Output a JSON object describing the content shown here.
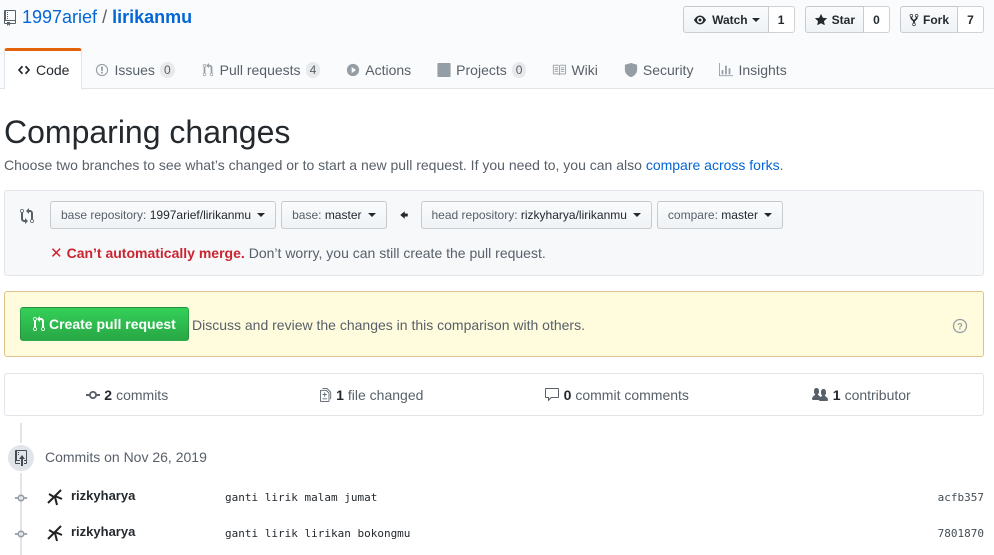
{
  "repo": {
    "owner": "1997arief",
    "separator": "/",
    "name": "lirikanmu"
  },
  "actions": {
    "watch_label": "Watch",
    "watch_count": "1",
    "star_label": "Star",
    "star_count": "0",
    "fork_label": "Fork",
    "fork_count": "7"
  },
  "nav": [
    {
      "label": "Code",
      "icon": "code-icon",
      "counter": null
    },
    {
      "label": "Issues",
      "icon": "issue-icon",
      "counter": "0"
    },
    {
      "label": "Pull requests",
      "icon": "pull-request-icon",
      "counter": "4"
    },
    {
      "label": "Actions",
      "icon": "play-icon",
      "counter": null
    },
    {
      "label": "Projects",
      "icon": "project-icon",
      "counter": "0"
    },
    {
      "label": "Wiki",
      "icon": "book-icon",
      "counter": null
    },
    {
      "label": "Security",
      "icon": "shield-icon",
      "counter": null
    },
    {
      "label": "Insights",
      "icon": "graph-icon",
      "counter": null
    }
  ],
  "compare": {
    "title": "Comparing changes",
    "description_prefix": "Choose two branches to see what’s changed or to start a new pull request. If you need to, you can also ",
    "description_link": "compare across forks",
    "description_suffix": ".",
    "base_repo_label": "base repository: ",
    "base_repo_value": "1997arief/lirikanmu",
    "base_label": "base: ",
    "base_value": "master",
    "head_repo_label": "head repository: ",
    "head_repo_value": "rizkyharya/lirikanmu",
    "compare_label": "compare: ",
    "compare_value": "master",
    "merge_error": "Can’t automatically merge.",
    "merge_note": "Don’t worry, you can still create the pull request.",
    "create_pr_label": "Create pull request",
    "create_pr_desc": "Discuss and review the changes in this comparison with others."
  },
  "summary": {
    "commits_count": "2",
    "commits_label": "commits",
    "files_count": "1",
    "files_label": "file changed",
    "comments_count": "0",
    "comments_label": "commit comments",
    "contributors_count": "1",
    "contributors_label": "contributor"
  },
  "commits": {
    "group_title": "Commits on Nov 26, 2019",
    "items": [
      {
        "author": "rizkyharya",
        "message": "ganti lirik malam jumat",
        "sha": "acfb357"
      },
      {
        "author": "rizkyharya",
        "message": "ganti lirik lirikan bokongmu",
        "sha": "7801870"
      }
    ]
  },
  "colors": {
    "link": "#0366d6",
    "accent_tab": "#e36209",
    "error": "#cb2431",
    "primary_button": "#28a745",
    "notice_bg": "#fffbdd"
  }
}
